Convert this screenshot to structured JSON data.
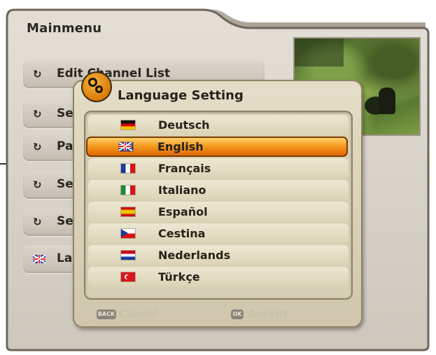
{
  "mainmenu": {
    "title": "Mainmenu",
    "items": [
      {
        "label": "Edit Channel List",
        "icon": "loop-arrow-icon"
      },
      {
        "label": "Se",
        "icon": "loop-arrow-icon"
      },
      {
        "label": "Pa",
        "icon": "loop-arrow-icon"
      },
      {
        "label": "Se",
        "icon": "loop-arrow-icon"
      },
      {
        "label": "Se",
        "icon": "loop-arrow-icon"
      },
      {
        "label": "La",
        "icon": "uk-flag-icon"
      }
    ]
  },
  "dialog": {
    "title": "Language Setting",
    "icon": "settings-gears-icon",
    "selected": "English",
    "languages": [
      {
        "name": "Deutsch",
        "flag": "germany-flag-icon"
      },
      {
        "name": "English",
        "flag": "uk-flag-icon"
      },
      {
        "name": "Français",
        "flag": "france-flag-icon"
      },
      {
        "name": "Italiano",
        "flag": "italy-flag-icon"
      },
      {
        "name": "Español",
        "flag": "spain-flag-icon"
      },
      {
        "name": "Cestina",
        "flag": "czech-flag-icon"
      },
      {
        "name": "Nederlands",
        "flag": "netherlands-flag-icon"
      },
      {
        "name": "Türkçe",
        "flag": "turkey-flag-icon"
      }
    ],
    "footer": {
      "back_key": "BACK",
      "back_label": "Cancel",
      "ok_key": "OK",
      "ok_label": "Accept"
    }
  },
  "colors": {
    "selection": "#f59a1f",
    "panel": "#d6d1c8",
    "dialog": "#dcd4bc"
  }
}
